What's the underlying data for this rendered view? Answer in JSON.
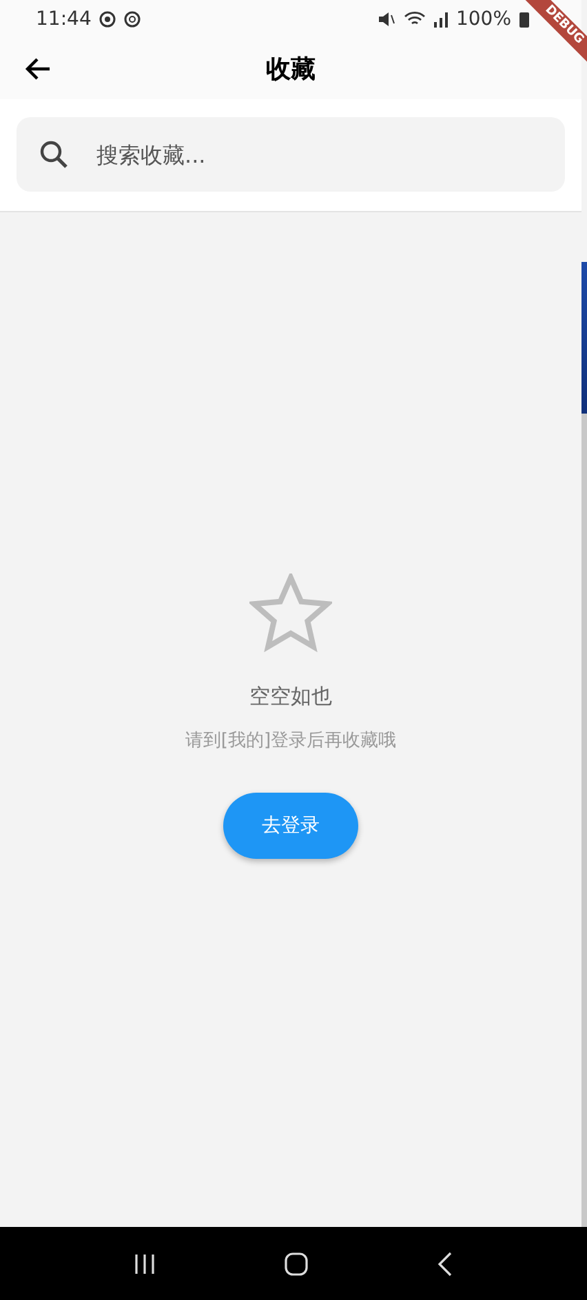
{
  "status_bar": {
    "time": "11:44",
    "battery": "100%"
  },
  "debug_banner": {
    "label": "DEBUG"
  },
  "app_bar": {
    "title": "收藏"
  },
  "search": {
    "placeholder": "搜索收藏..."
  },
  "empty_state": {
    "title": "空空如也",
    "message": "请到[我的]登录后再收藏哦",
    "button": "去登录"
  }
}
